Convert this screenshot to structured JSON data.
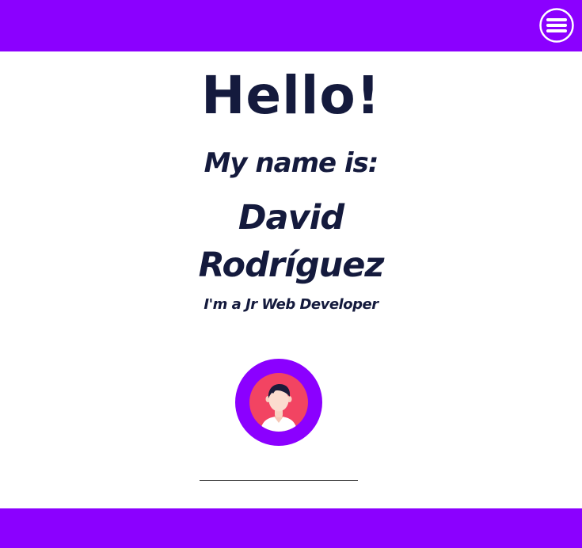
{
  "colors": {
    "brand": "#8b00ff",
    "text": "#141a3d",
    "avatar_ring": "#8b00ff",
    "avatar_inner": "#f24462",
    "white": "#ffffff"
  },
  "header": {
    "menu_icon": "hamburger-menu-icon"
  },
  "hero": {
    "greeting": "Hello!",
    "intro": "My name is:",
    "first_name": "David",
    "last_name": "Rodríguez",
    "role": "I'm a Jr Web Developer",
    "avatar_icon": "user-avatar-icon"
  }
}
